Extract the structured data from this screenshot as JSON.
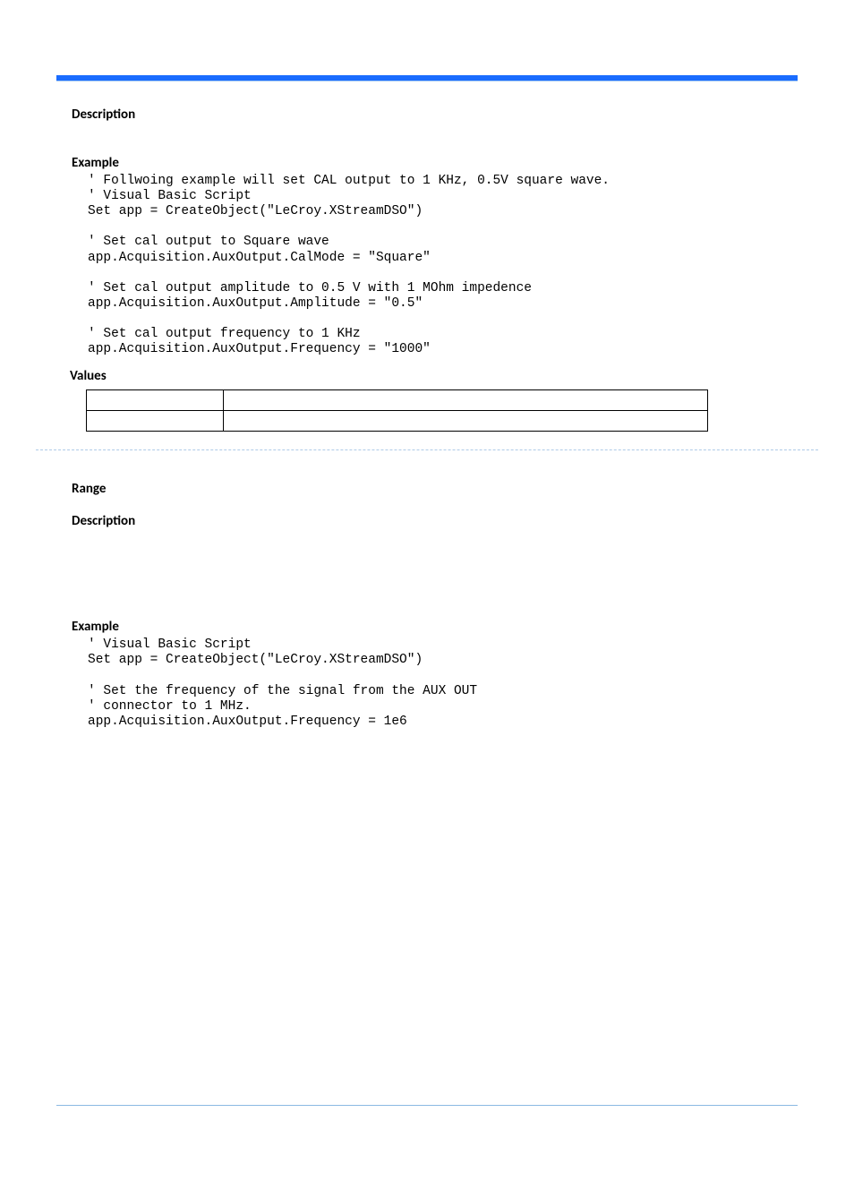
{
  "sec1": {
    "description_heading": "Description",
    "example_heading": "Example",
    "code": "' Follwoing example will set CAL output to 1 KHz, 0.5V square wave.\n' Visual Basic Script\nSet app = CreateObject(\"LeCroy.XStreamDSO\")\n\n' Set cal output to Square wave\napp.Acquisition.AuxOutput.CalMode = \"Square\"\n\n' Set cal output amplitude to 0.5 V with 1 MOhm impedence\napp.Acquisition.AuxOutput.Amplitude = \"0.5\"\n\n' Set cal output frequency to 1 KHz\napp.Acquisition.AuxOutput.Frequency = \"1000\"",
    "values_heading": "Values",
    "table": {
      "rows": [
        {
          "c1": "",
          "c2": ""
        },
        {
          "c1": "",
          "c2": ""
        }
      ]
    }
  },
  "sec2": {
    "range_heading": "Range",
    "description_heading": "Description",
    "example_heading": "Example",
    "code": "' Visual Basic Script\nSet app = CreateObject(\"LeCroy.XStreamDSO\")\n\n' Set the frequency of the signal from the AUX OUT\n' connector to 1 MHz.\napp.Acquisition.AuxOutput.Frequency = 1e6"
  }
}
